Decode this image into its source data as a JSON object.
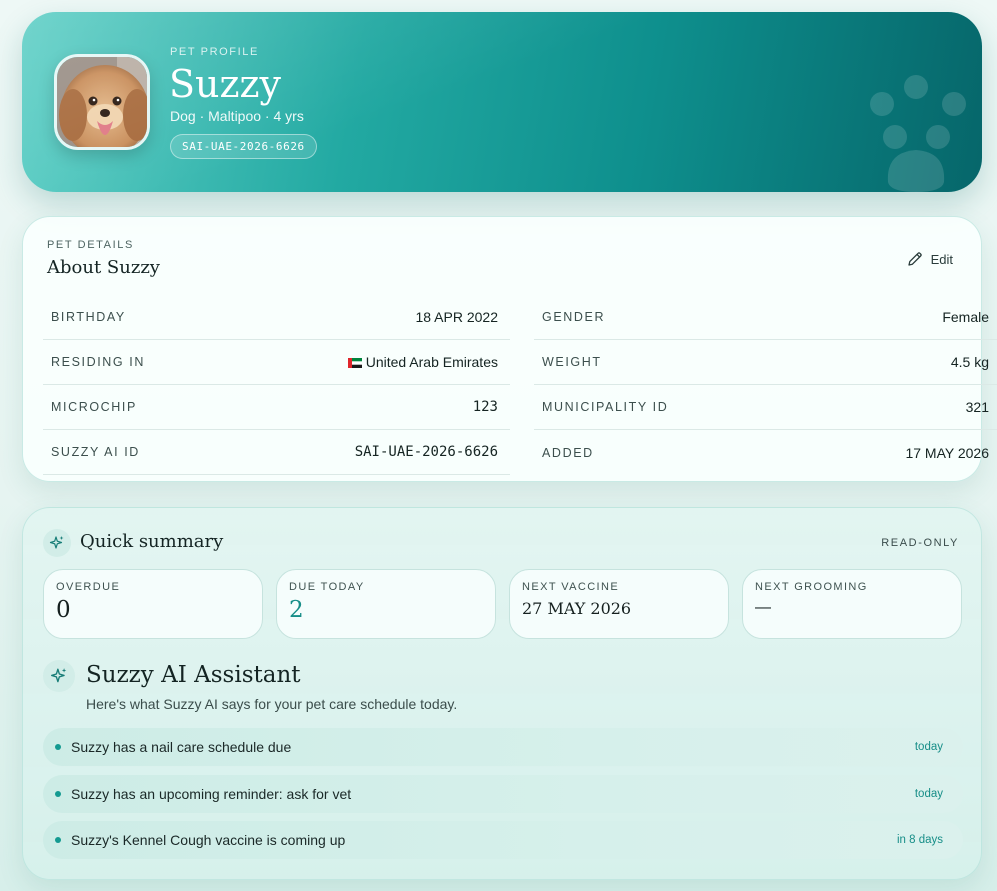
{
  "hero": {
    "eyebrow": "PET PROFILE",
    "name": "Suzzy",
    "subtitle": "Dog · Maltipoo · 4 yrs",
    "id_badge": "SAI-UAE-2026-6626",
    "icons": [
      "pet-photo",
      "paw-icon"
    ]
  },
  "details": {
    "eyebrow": "PET DETAILS",
    "title": "About Suzzy",
    "edit_label": "Edit",
    "left": [
      {
        "label": "BIRTHDAY",
        "value": "18 APR 2022"
      },
      {
        "label": "RESIDING IN",
        "value": "United Arab Emirates"
      },
      {
        "label": "MICROCHIP",
        "value": "123"
      },
      {
        "label": "SUZZY AI ID",
        "value": "SAI-UAE-2026-6626"
      }
    ],
    "right": [
      {
        "label": "GENDER",
        "value": "Female"
      },
      {
        "label": "WEIGHT",
        "value": "4.5 kg"
      },
      {
        "label": "MUNICIPALITY ID",
        "value": "321"
      },
      {
        "label": "ADDED",
        "value": "17 MAY 2026"
      }
    ]
  },
  "summary": {
    "title": "Quick summary",
    "mode": "READ-ONLY",
    "stats": [
      {
        "label": "OVERDUE",
        "value": "0"
      },
      {
        "label": "DUE TODAY",
        "value": "2"
      },
      {
        "label": "NEXT VACCINE",
        "value": "27 MAY 2026"
      },
      {
        "label": "NEXT GROOMING",
        "value": "—"
      }
    ]
  },
  "assistant": {
    "title": "Suzzy AI Assistant",
    "subtitle": "Here's what Suzzy AI says for your pet care schedule today.",
    "items": [
      {
        "text": "Suzzy has a nail care schedule due",
        "when": "today"
      },
      {
        "text": "Suzzy has an upcoming reminder: ask for vet",
        "when": "today"
      },
      {
        "text": "Suzzy's Kennel Cough vaccine is coming up",
        "when": "in 8 days"
      }
    ]
  },
  "colors": {
    "accent": "#178e88",
    "hero_start": "#5fcfc6",
    "hero_end": "#06666a"
  }
}
